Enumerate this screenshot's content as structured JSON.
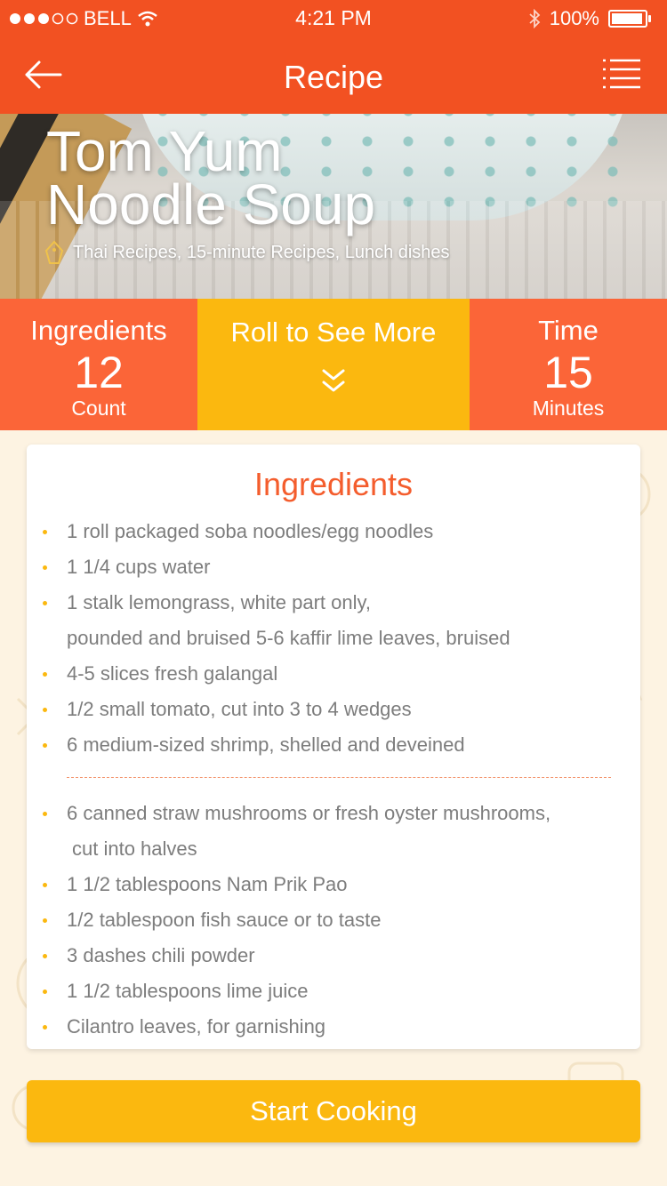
{
  "status_bar": {
    "carrier": "BELL",
    "time": "4:21 PM",
    "battery": "100%",
    "battery_level": 1.0,
    "signal_bars_filled": 3,
    "signal_bars_total": 5
  },
  "nav": {
    "title": "Recipe",
    "back_icon": "arrow-left-icon",
    "menu_icon": "list-menu-icon"
  },
  "hero": {
    "title": "Tom Yum\nNoodle Soup",
    "categories": "Thai Recipes, 15-minute Recipes, Lunch dishes",
    "tag_icon": "tag-icon"
  },
  "stats": {
    "ingredients_label": "Ingredients",
    "ingredients_value": "12",
    "ingredients_unit": "Count",
    "roll_label": "Roll to See More",
    "time_label": "Time",
    "time_value": "15",
    "time_unit": "Minutes"
  },
  "ingredients": {
    "title": "Ingredients",
    "group1": [
      "1 roll packaged soba noodles/egg noodles",
      "1 1/4 cups water",
      "1 stalk lemongrass, white part only,",
      "4-5 slices fresh galangal",
      "1/2 small tomato, cut into 3 to 4 wedges",
      "6 medium-sized shrimp, shelled and deveined"
    ],
    "group1_cont": "pounded and bruised 5-6 kaffir lime leaves, bruised",
    "group2": [
      "6 canned straw mushrooms or fresh oyster mushrooms,",
      "1 1/2 tablespoons Nam Prik Pao",
      "1/2 tablespoon fish sauce or to taste",
      "3 dashes chili powder",
      "1 1/2 tablespoons lime juice",
      "Cilantro leaves, for garnishing"
    ],
    "group2_cont": "cut into halves"
  },
  "actions": {
    "start_label": "Start Cooking"
  },
  "colors": {
    "brand_orange": "#f25122",
    "stat_orange": "#fb6538",
    "accent_yellow": "#fbb80f",
    "title_orange": "#f45d2d",
    "text_gray": "#7d7d7d",
    "background": "#fdf3e2"
  }
}
